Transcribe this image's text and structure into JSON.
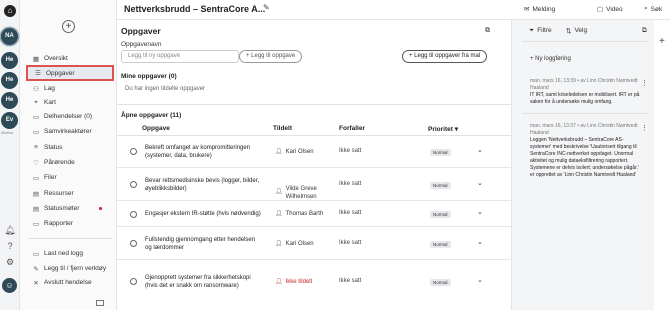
{
  "rail": {
    "logo": "⌂",
    "avatars": [
      "NA",
      "He",
      "He",
      "He",
      "Ev"
    ],
    "footer_label": "Øvelse"
  },
  "sidebar": {
    "add_label": "+",
    "items": [
      {
        "label": "Oversikt",
        "icon": "grid-icon",
        "glyph": "▦"
      },
      {
        "label": "Oppgaver",
        "icon": "tasks-icon",
        "glyph": "☰"
      },
      {
        "label": "Lag",
        "icon": "team-icon",
        "glyph": "⚇"
      },
      {
        "label": "Kart",
        "icon": "map-icon",
        "glyph": "⌖"
      },
      {
        "label": "Delhendelser (0)",
        "icon": "subincident-icon",
        "glyph": "▭"
      },
      {
        "label": "Samvirkeaktører",
        "icon": "partners-icon",
        "glyph": "▭"
      },
      {
        "label": "Status",
        "icon": "status-icon",
        "glyph": "≡"
      },
      {
        "label": "Pårørende",
        "icon": "relatives-icon",
        "glyph": "♡"
      },
      {
        "label": "Filer",
        "icon": "files-icon",
        "glyph": "▭"
      },
      {
        "label": "Ressurser",
        "icon": "resources-icon",
        "glyph": "▤"
      },
      {
        "label": "Statusmøter",
        "icon": "meetings-icon",
        "glyph": "▤"
      },
      {
        "label": "Rapporter",
        "icon": "reports-icon",
        "glyph": "▭"
      }
    ],
    "footer_items": [
      {
        "label": "Last ned logg",
        "icon": "download-icon",
        "glyph": "▭"
      },
      {
        "label": "Legg til / fjern verktøy",
        "icon": "tools-icon",
        "glyph": "✎"
      },
      {
        "label": "Avslutt hendelse",
        "icon": "close-icon",
        "glyph": "✕"
      }
    ]
  },
  "header": {
    "title": "Nettverksbrudd – SentraCore A...",
    "buttons": [
      {
        "label": "Melding",
        "glyph": "✉"
      },
      {
        "label": "Video",
        "glyph": "▢"
      },
      {
        "label": "Søk",
        "glyph": "⌕"
      }
    ]
  },
  "main": {
    "title": "Oppgaver",
    "task_name_label": "Oppgavenavn",
    "task_input_placeholder": "Legg til ny oppgave",
    "add_task_button": "+ Legg til oppgave",
    "add_from_template_button": "+ Legg til oppgaver fra mal",
    "my_tasks_heading": "Mine oppgaver (0)",
    "my_tasks_empty": "Du har ingen tildelte oppgaver",
    "open_tasks_heading": "Åpne oppgaver (11)",
    "columns": {
      "task": "Oppgave",
      "assigned": "Tildelt",
      "deadline": "Forfaller",
      "priority": "Prioritet"
    },
    "rows": [
      {
        "task": "Bekreft omfanget av kompromitteringen (systemer, data, brukere)",
        "assigned": "Kari Olsen",
        "unassigned": false,
        "deadline": "Ikke satt",
        "priority": "Normal"
      },
      {
        "task": "Bevar rettsmedisinske bevis (logger, bilder, øyeblikksbilder)",
        "assigned": "Vilde Greve Wilhelmsen",
        "unassigned": false,
        "deadline": "Ikke satt",
        "priority": "Normal"
      },
      {
        "task": "Engasjer ekstern IR-støtte (hvis nødvendig)",
        "assigned": "Thomas Barth",
        "unassigned": false,
        "deadline": "Ikke satt",
        "priority": "Normal"
      },
      {
        "task": "Fullstendig gjennomgang etter hendelsen og lærdommer",
        "assigned": "Kari Olsen",
        "unassigned": false,
        "deadline": "Ikke satt",
        "priority": "Normal"
      },
      {
        "task": "Gjenopprett systemer fra sikkerhetskopi (hvis det er snakk om ransomware)",
        "assigned": "Ikke tildelt",
        "unassigned": true,
        "deadline": "Ikke satt",
        "priority": "Normal"
      }
    ]
  },
  "right": {
    "filter_label": "Filtre",
    "select_label": "Velg",
    "new_log_label": "+ Ny loggføring",
    "logs": [
      {
        "meta": "man. mars 16, 13:39 • av Linn Christin Namtvedt Haaland",
        "text": "IT IRT, samt kriseledelsen er mobilisert. IRT er på saken for å undersøke mulig omfang."
      },
      {
        "meta": "man. mars 16, 13:37 • av Linn Christin Namtvedt Haaland",
        "text": "Loggen 'Nettverksbrudd – SentraCore AS-systemer' med beskrivelse 'Uautorisert tilgang til SentraCore INC-nettverket oppdaget. Unormal aktivitet og mulig dataeksfiltrering rapportert. Systemene er delvis isolert; undersøkelse pågår.' er opprettet av 'Linn Christin Namtvedt Haaland'"
      }
    ]
  }
}
